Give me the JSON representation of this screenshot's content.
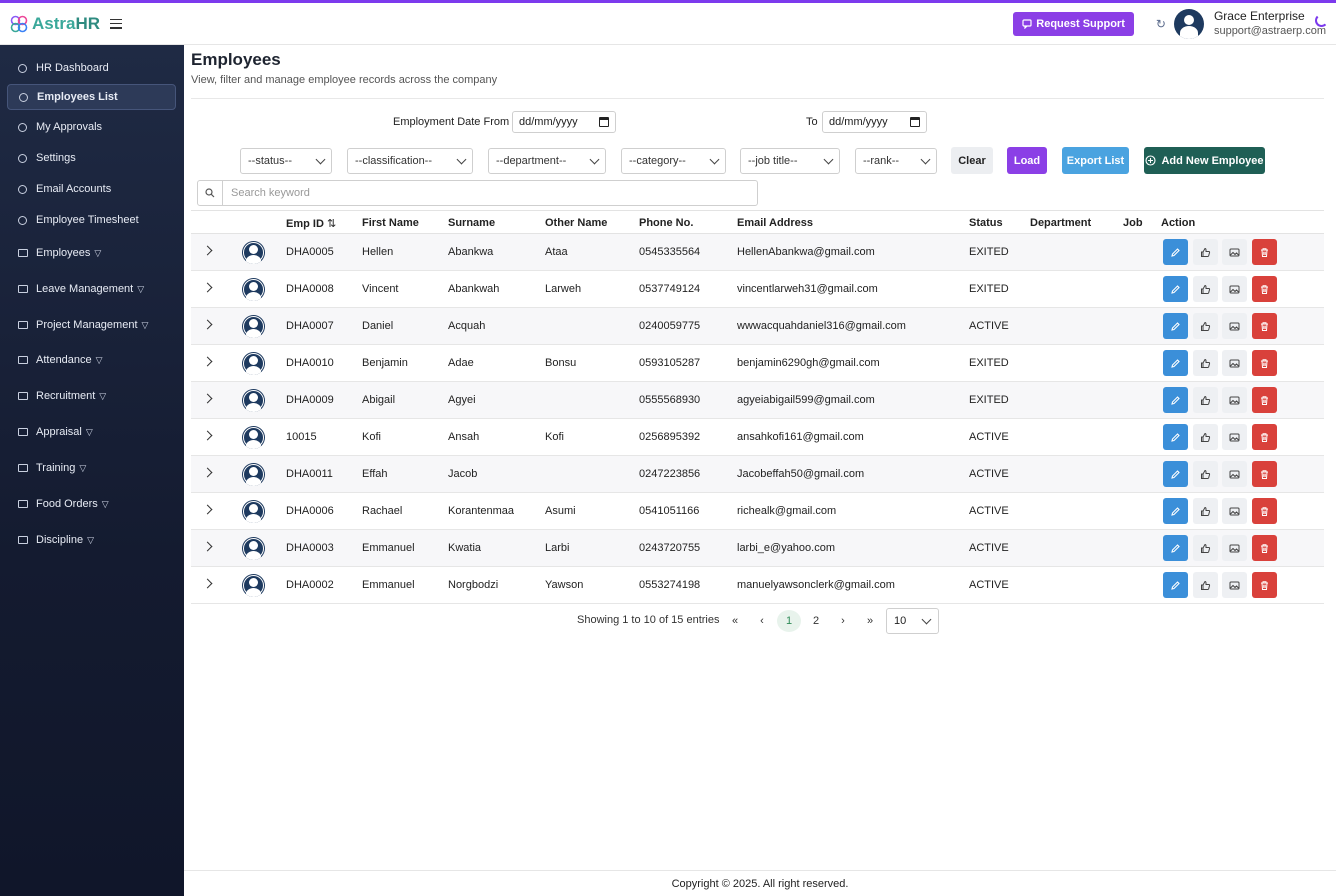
{
  "brand": {
    "name_part1": "Astra",
    "name_part2": "HR"
  },
  "header": {
    "support_label": "Request Support",
    "user_name": "Grace Enterprise",
    "user_email": "support@astraerp.com"
  },
  "sidebar": {
    "items": [
      {
        "label": "HR Dashboard",
        "type": "link"
      },
      {
        "label": "Employees List",
        "type": "link",
        "active": true
      },
      {
        "label": "My Approvals",
        "type": "link"
      },
      {
        "label": "Settings",
        "type": "link"
      },
      {
        "label": "Email Accounts",
        "type": "link"
      },
      {
        "label": "Employee Timesheet",
        "type": "link"
      },
      {
        "label": "Employees",
        "type": "folder"
      },
      {
        "label": "Leave Management",
        "type": "folder"
      },
      {
        "label": "Project Management",
        "type": "folder"
      },
      {
        "label": "Attendance",
        "type": "folder"
      },
      {
        "label": "Recruitment",
        "type": "folder"
      },
      {
        "label": "Appraisal",
        "type": "folder"
      },
      {
        "label": "Training",
        "type": "folder"
      },
      {
        "label": "Food Orders",
        "type": "folder"
      },
      {
        "label": "Discipline",
        "type": "folder"
      }
    ]
  },
  "page": {
    "title": "Employees",
    "subtitle": "View, filter and manage employee records across the company"
  },
  "filters": {
    "date_from_label": "Employment Date From",
    "date_from_placeholder": "dd/mm/yyyy",
    "date_to_label": "To",
    "date_to_placeholder": "dd/mm/yyyy",
    "status": "--status--",
    "classification": "--classification--",
    "department": "--department--",
    "category": "--category--",
    "job_title": "--job title--",
    "rank": "--rank--",
    "clear_label": "Clear",
    "load_label": "Load",
    "export_label": "Export List",
    "add_label": "Add New Employee",
    "search_placeholder": "Search keyword"
  },
  "table": {
    "columns": [
      "Emp ID",
      "First Name",
      "Surname",
      "Other Name",
      "Phone No.",
      "Email Address",
      "Status",
      "Department",
      "Job",
      "Action"
    ],
    "rows": [
      {
        "id": "DHA0005",
        "first": "Hellen",
        "surname": "Abankwa",
        "other": "Ataa",
        "phone": "0545335564",
        "email": "HellenAbankwa@gmail.com",
        "status": "EXITED",
        "department": "",
        "job": ""
      },
      {
        "id": "DHA0008",
        "first": "Vincent",
        "surname": "Abankwah",
        "other": "Larweh",
        "phone": "0537749124",
        "email": "vincentlarweh31@gmail.com",
        "status": "EXITED",
        "department": "",
        "job": ""
      },
      {
        "id": "DHA0007",
        "first": "Daniel",
        "surname": "Acquah",
        "other": "",
        "phone": "0240059775",
        "email": "wwwacquahdaniel316@gmail.com",
        "status": "ACTIVE",
        "department": "",
        "job": ""
      },
      {
        "id": "DHA0010",
        "first": "Benjamin",
        "surname": "Adae",
        "other": "Bonsu",
        "phone": "0593105287",
        "email": "benjamin6290gh@gmail.com",
        "status": "EXITED",
        "department": "",
        "job": ""
      },
      {
        "id": "DHA0009",
        "first": "Abigail",
        "surname": "Agyei",
        "other": "",
        "phone": "0555568930",
        "email": "agyeiabigail599@gmail.com",
        "status": "EXITED",
        "department": "",
        "job": ""
      },
      {
        "id": "10015",
        "first": "Kofi",
        "surname": "Ansah",
        "other": "Kofi",
        "phone": "0256895392",
        "email": "ansahkofi161@gmail.com",
        "status": "ACTIVE",
        "department": "",
        "job": ""
      },
      {
        "id": "DHA0011",
        "first": "Effah",
        "surname": "Jacob",
        "other": "",
        "phone": "0247223856",
        "email": "Jacobeffah50@gmail.com",
        "status": "ACTIVE",
        "department": "",
        "job": ""
      },
      {
        "id": "DHA0006",
        "first": "Rachael",
        "surname": "Korantenmaa",
        "other": "Asumi",
        "phone": "0541051166",
        "email": "richealk@gmail.com",
        "status": "ACTIVE",
        "department": "",
        "job": ""
      },
      {
        "id": "DHA0003",
        "first": "Emmanuel",
        "surname": "Kwatia",
        "other": "Larbi",
        "phone": "0243720755",
        "email": "larbi_e@yahoo.com",
        "status": "ACTIVE",
        "department": "",
        "job": ""
      },
      {
        "id": "DHA0002",
        "first": "Emmanuel",
        "surname": "Norgbodzi",
        "other": "Yawson",
        "phone": "0553274198",
        "email": "manuelyawsonclerk@gmail.com",
        "status": "ACTIVE",
        "department": "",
        "job": ""
      }
    ]
  },
  "pagination": {
    "info": "Showing 1 to 10 of 15 entries",
    "first": "«",
    "prev": "‹",
    "pages": [
      "1",
      "2"
    ],
    "current": "1",
    "next": "›",
    "last": "»",
    "page_size": "10"
  },
  "footer": {
    "text": "Copyright © 2025. All right reserved."
  },
  "colors": {
    "accent": "#8b3fe6",
    "brand": "#3aa89a",
    "edit": "#3b8fd9",
    "delete": "#d9413b",
    "add": "#1f5f55",
    "sidebar": "#1f2a44"
  }
}
